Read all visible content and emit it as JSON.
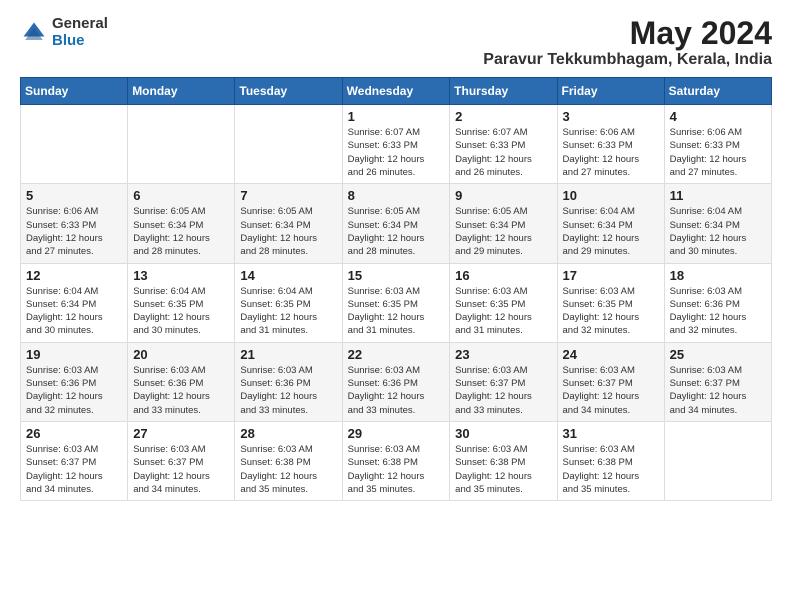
{
  "header": {
    "logo_line1": "General",
    "logo_line2": "Blue",
    "month": "May 2024",
    "location": "Paravur Tekkumbhagam, Kerala, India"
  },
  "weekdays": [
    "Sunday",
    "Monday",
    "Tuesday",
    "Wednesday",
    "Thursday",
    "Friday",
    "Saturday"
  ],
  "weeks": [
    [
      {
        "day": "",
        "info": ""
      },
      {
        "day": "",
        "info": ""
      },
      {
        "day": "",
        "info": ""
      },
      {
        "day": "1",
        "info": "Sunrise: 6:07 AM\nSunset: 6:33 PM\nDaylight: 12 hours\nand 26 minutes."
      },
      {
        "day": "2",
        "info": "Sunrise: 6:07 AM\nSunset: 6:33 PM\nDaylight: 12 hours\nand 26 minutes."
      },
      {
        "day": "3",
        "info": "Sunrise: 6:06 AM\nSunset: 6:33 PM\nDaylight: 12 hours\nand 27 minutes."
      },
      {
        "day": "4",
        "info": "Sunrise: 6:06 AM\nSunset: 6:33 PM\nDaylight: 12 hours\nand 27 minutes."
      }
    ],
    [
      {
        "day": "5",
        "info": "Sunrise: 6:06 AM\nSunset: 6:33 PM\nDaylight: 12 hours\nand 27 minutes."
      },
      {
        "day": "6",
        "info": "Sunrise: 6:05 AM\nSunset: 6:34 PM\nDaylight: 12 hours\nand 28 minutes."
      },
      {
        "day": "7",
        "info": "Sunrise: 6:05 AM\nSunset: 6:34 PM\nDaylight: 12 hours\nand 28 minutes."
      },
      {
        "day": "8",
        "info": "Sunrise: 6:05 AM\nSunset: 6:34 PM\nDaylight: 12 hours\nand 28 minutes."
      },
      {
        "day": "9",
        "info": "Sunrise: 6:05 AM\nSunset: 6:34 PM\nDaylight: 12 hours\nand 29 minutes."
      },
      {
        "day": "10",
        "info": "Sunrise: 6:04 AM\nSunset: 6:34 PM\nDaylight: 12 hours\nand 29 minutes."
      },
      {
        "day": "11",
        "info": "Sunrise: 6:04 AM\nSunset: 6:34 PM\nDaylight: 12 hours\nand 30 minutes."
      }
    ],
    [
      {
        "day": "12",
        "info": "Sunrise: 6:04 AM\nSunset: 6:34 PM\nDaylight: 12 hours\nand 30 minutes."
      },
      {
        "day": "13",
        "info": "Sunrise: 6:04 AM\nSunset: 6:35 PM\nDaylight: 12 hours\nand 30 minutes."
      },
      {
        "day": "14",
        "info": "Sunrise: 6:04 AM\nSunset: 6:35 PM\nDaylight: 12 hours\nand 31 minutes."
      },
      {
        "day": "15",
        "info": "Sunrise: 6:03 AM\nSunset: 6:35 PM\nDaylight: 12 hours\nand 31 minutes."
      },
      {
        "day": "16",
        "info": "Sunrise: 6:03 AM\nSunset: 6:35 PM\nDaylight: 12 hours\nand 31 minutes."
      },
      {
        "day": "17",
        "info": "Sunrise: 6:03 AM\nSunset: 6:35 PM\nDaylight: 12 hours\nand 32 minutes."
      },
      {
        "day": "18",
        "info": "Sunrise: 6:03 AM\nSunset: 6:36 PM\nDaylight: 12 hours\nand 32 minutes."
      }
    ],
    [
      {
        "day": "19",
        "info": "Sunrise: 6:03 AM\nSunset: 6:36 PM\nDaylight: 12 hours\nand 32 minutes."
      },
      {
        "day": "20",
        "info": "Sunrise: 6:03 AM\nSunset: 6:36 PM\nDaylight: 12 hours\nand 33 minutes."
      },
      {
        "day": "21",
        "info": "Sunrise: 6:03 AM\nSunset: 6:36 PM\nDaylight: 12 hours\nand 33 minutes."
      },
      {
        "day": "22",
        "info": "Sunrise: 6:03 AM\nSunset: 6:36 PM\nDaylight: 12 hours\nand 33 minutes."
      },
      {
        "day": "23",
        "info": "Sunrise: 6:03 AM\nSunset: 6:37 PM\nDaylight: 12 hours\nand 33 minutes."
      },
      {
        "day": "24",
        "info": "Sunrise: 6:03 AM\nSunset: 6:37 PM\nDaylight: 12 hours\nand 34 minutes."
      },
      {
        "day": "25",
        "info": "Sunrise: 6:03 AM\nSunset: 6:37 PM\nDaylight: 12 hours\nand 34 minutes."
      }
    ],
    [
      {
        "day": "26",
        "info": "Sunrise: 6:03 AM\nSunset: 6:37 PM\nDaylight: 12 hours\nand 34 minutes."
      },
      {
        "day": "27",
        "info": "Sunrise: 6:03 AM\nSunset: 6:37 PM\nDaylight: 12 hours\nand 34 minutes."
      },
      {
        "day": "28",
        "info": "Sunrise: 6:03 AM\nSunset: 6:38 PM\nDaylight: 12 hours\nand 35 minutes."
      },
      {
        "day": "29",
        "info": "Sunrise: 6:03 AM\nSunset: 6:38 PM\nDaylight: 12 hours\nand 35 minutes."
      },
      {
        "day": "30",
        "info": "Sunrise: 6:03 AM\nSunset: 6:38 PM\nDaylight: 12 hours\nand 35 minutes."
      },
      {
        "day": "31",
        "info": "Sunrise: 6:03 AM\nSunset: 6:38 PM\nDaylight: 12 hours\nand 35 minutes."
      },
      {
        "day": "",
        "info": ""
      }
    ]
  ]
}
